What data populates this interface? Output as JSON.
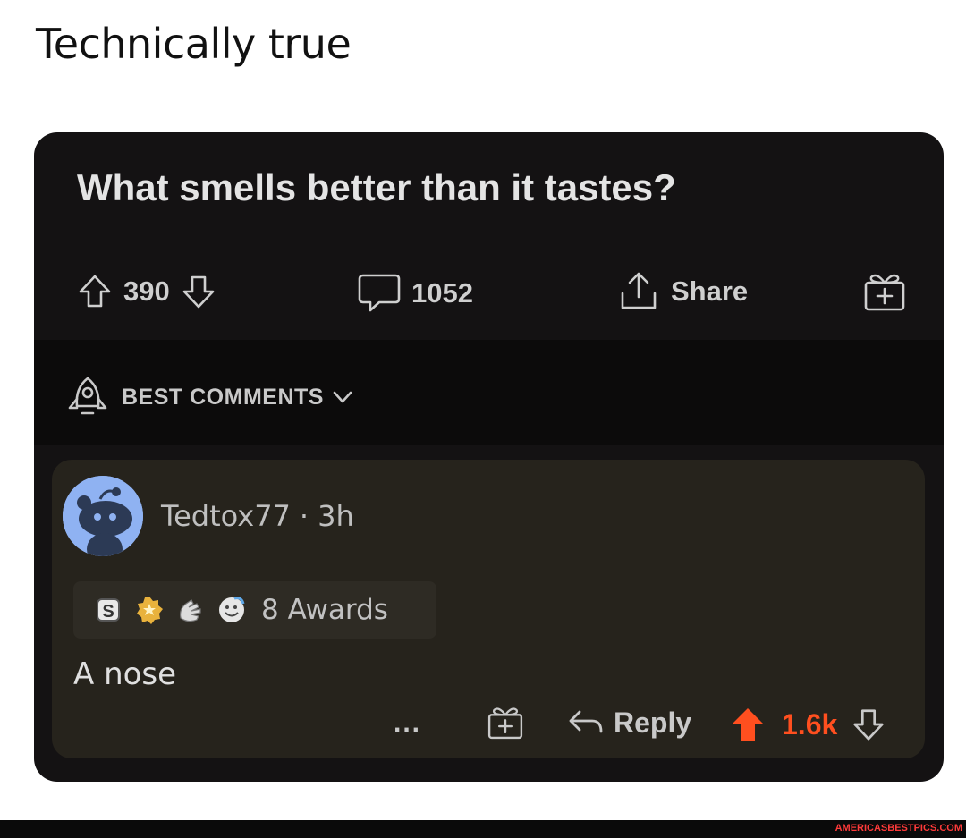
{
  "caption": "Technically true",
  "post": {
    "title": "What smells better than it tastes?",
    "score": "390",
    "comments_count": "1052",
    "share_label": "Share"
  },
  "sort": {
    "label": "BEST COMMENTS"
  },
  "comment": {
    "author": "Tedtox77",
    "separator": "·",
    "age": "3h",
    "awards_label": "8 Awards",
    "body": "A nose",
    "more_label": "...",
    "reply_label": "Reply",
    "score": "1.6k"
  },
  "colors": {
    "card_bg": "#141213",
    "comment_bg": "#26231c",
    "upvote_active": "#ff4f1f",
    "avatar_bg": "#8fb2f2"
  },
  "footer": {
    "watermark": "AMERICASBESTPICS.COM"
  }
}
